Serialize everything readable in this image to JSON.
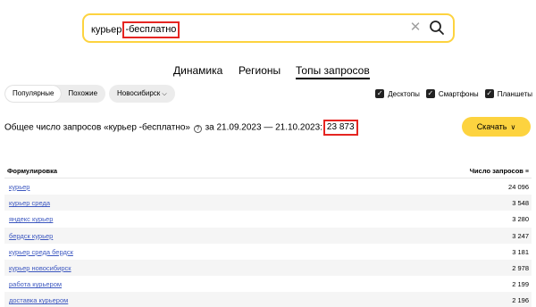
{
  "search": {
    "query_prefix": "курьер",
    "query_highlighted": "-бесплатно"
  },
  "tabs": [
    {
      "label": "Динамика",
      "active": false
    },
    {
      "label": "Регионы",
      "active": false
    },
    {
      "label": "Топы запросов",
      "active": true
    }
  ],
  "segments": [
    {
      "label": "Популярные",
      "active": true
    },
    {
      "label": "Похожие",
      "active": false
    }
  ],
  "region": {
    "label": "Новосибирск"
  },
  "devices": [
    {
      "label": "Десктопы",
      "checked": true
    },
    {
      "label": "Смартфоны",
      "checked": true
    },
    {
      "label": "Планшеты",
      "checked": true
    }
  ],
  "summary": {
    "text": "Общее число запросов «курьер -бесплатно»",
    "period": "за 21.09.2023 — 21.10.2023:",
    "total": "23 873"
  },
  "download": {
    "label": "Скачать"
  },
  "table": {
    "col_phrase": "Формулировка",
    "col_count": "Число запросов",
    "rows": [
      {
        "phrase": "курьер",
        "count": "24 096"
      },
      {
        "phrase": "курьер среда",
        "count": "3 548"
      },
      {
        "phrase": "яндекс курьер",
        "count": "3 280"
      },
      {
        "phrase": "бердск курьер",
        "count": "3 247"
      },
      {
        "phrase": "курьер среда бердск",
        "count": "3 181"
      },
      {
        "phrase": "курьер новосибирск",
        "count": "2 978"
      },
      {
        "phrase": "работа курьером",
        "count": "2 199"
      },
      {
        "phrase": "доставка курьером",
        "count": "2 196"
      }
    ]
  },
  "colors": {
    "accent_yellow": "#fdd33f",
    "highlight_red": "#e52521",
    "link_blue": "#3d58c0"
  }
}
